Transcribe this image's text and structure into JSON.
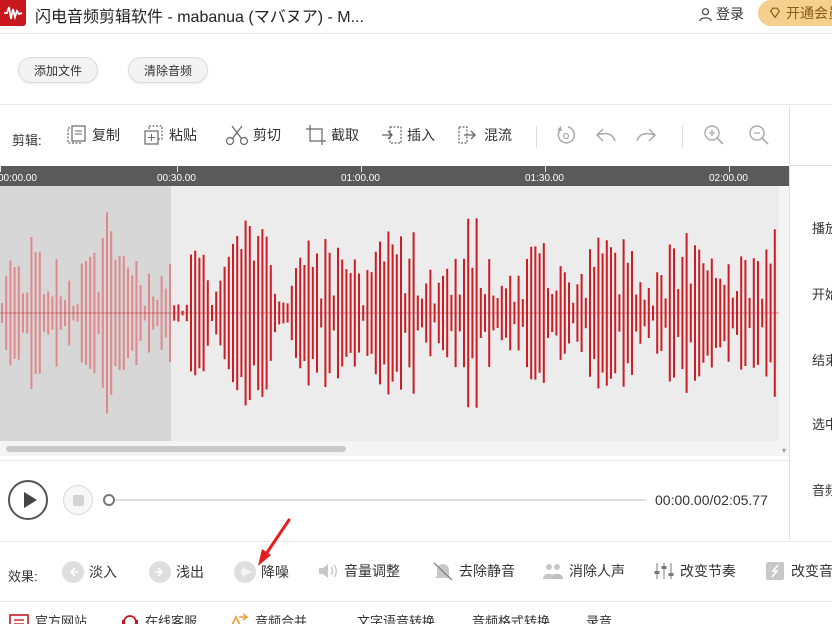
{
  "window": {
    "title": "闪电音频剪辑软件 - mabanua (マバヌア) - M...",
    "login_label": "登录",
    "vip_label": "开通会员"
  },
  "file_actions": {
    "add_file": "添加文件",
    "clear_audio": "清除音频"
  },
  "edit_toolbar": {
    "label": "剪辑:",
    "copy": "复制",
    "paste": "粘贴",
    "cut": "剪切",
    "trim": "截取",
    "insert": "插入",
    "mix": "混流"
  },
  "timeline": {
    "ticks": [
      "00:00.00",
      "00:30.00",
      "01:00.00",
      "01:30.00",
      "02:00.00"
    ]
  },
  "player": {
    "time": "00:00.00/02:05.77",
    "progress": 0
  },
  "right_panel": {
    "labels": [
      "播放",
      "开始",
      "结束",
      "选中",
      "音频"
    ]
  },
  "effects": {
    "label": "效果:",
    "items": [
      "淡入",
      "浅出",
      "降噪",
      "音量调整",
      "去除静音",
      "消除人声",
      "改变节奏",
      "改变音调"
    ]
  },
  "bottom_links": {
    "official_site": "官方网站",
    "online_service": "在线客服",
    "audio_merge": "音频合并",
    "tts": "文字语音转换",
    "format_convert": "音频格式转换",
    "record": "录音"
  },
  "colors": {
    "waveform": "#cc1d24",
    "waveform_selected": "#e0888b",
    "brand": "#c8181e",
    "vip": "#f4cf8e"
  }
}
